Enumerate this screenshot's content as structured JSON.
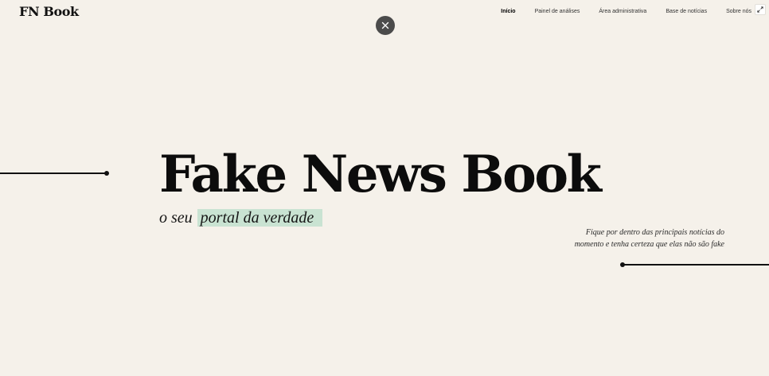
{
  "header": {
    "logo": "FN Book",
    "nav": [
      {
        "label": "Início",
        "active": true
      },
      {
        "label": "Painel de análises",
        "active": false
      },
      {
        "label": "Área administrativa",
        "active": false
      },
      {
        "label": "Base de notícias",
        "active": false
      },
      {
        "label": "Sobre nós",
        "active": false
      }
    ],
    "expand_icon": "expand-icon"
  },
  "overlay": {
    "close_icon": "close-icon"
  },
  "hero": {
    "title": "Fake News Book",
    "tagline_prefix": "o seu ",
    "tagline_highlight": "portal da verdade",
    "side_line_1": "Fique por dentro das principais notícias do",
    "side_line_2": "momento e tenha certeza que elas não são fake"
  },
  "colors": {
    "background": "#f5f1ea",
    "highlight": "#c9e3d2",
    "close_button": "#4b4b4b",
    "text": "#111111"
  }
}
